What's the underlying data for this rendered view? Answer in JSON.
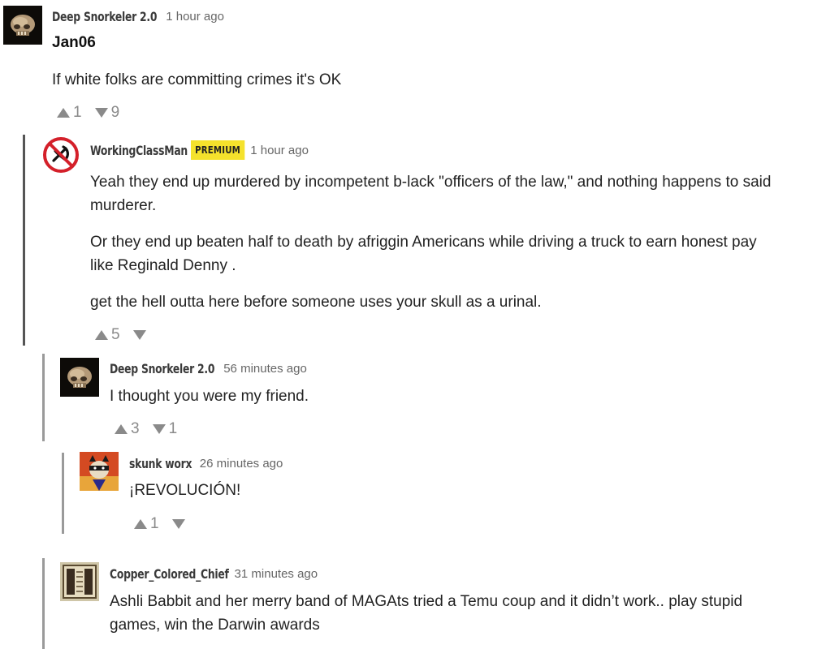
{
  "comments": [
    {
      "username": "Deep Snorkeler 2.0",
      "time": "1 hour ago",
      "title": "Jan06",
      "paragraphs": [
        "If white folks are committing crimes it's OK"
      ],
      "upvotes": "1",
      "downvotes": "9"
    },
    {
      "username": "WorkingClassMan",
      "badge": "PREMIUM",
      "time": "1 hour ago",
      "paragraphs": [
        "Yeah they end up murdered by incompetent b-lack \"officers of the law,\" and nothing happens to said",
        "murderer.",
        "Or they end up beaten half to death by afriggin Americans while driving a truck to earn honest pay",
        "like Reginald Denny .",
        "get the hell outta here before someone uses your skull as a urinal."
      ],
      "upvotes": "5",
      "downvotes": ""
    },
    {
      "username": "Deep Snorkeler 2.0",
      "time": "56 minutes ago",
      "paragraphs": [
        "I thought you were my friend."
      ],
      "upvotes": "3",
      "downvotes": "1"
    },
    {
      "username": "skunk worx",
      "time": "26 minutes ago",
      "paragraphs": [
        "¡REVOLUCIÓN!"
      ],
      "upvotes": "1",
      "downvotes": ""
    },
    {
      "username": "Copper_Colored_Chief",
      "time": "31 minutes ago",
      "paragraphs": [
        "Ashli Babbit and her merry band of MAGAts tried a Temu coup and it didn’t work.. play stupid",
        "games, win the Darwin awards"
      ]
    }
  ],
  "colors": {
    "badge": "#f5e22c",
    "vote_arrow": "#8a8a8a",
    "thread_bar_dark": "#555555",
    "thread_bar_light": "#9a9a9a"
  },
  "icons": [
    "skull-avatar-icon",
    "anti-communist-avatar-icon",
    "raccoon-avatar-icon",
    "document-avatar-icon",
    "upvote-arrow-icon",
    "downvote-arrow-icon"
  ]
}
